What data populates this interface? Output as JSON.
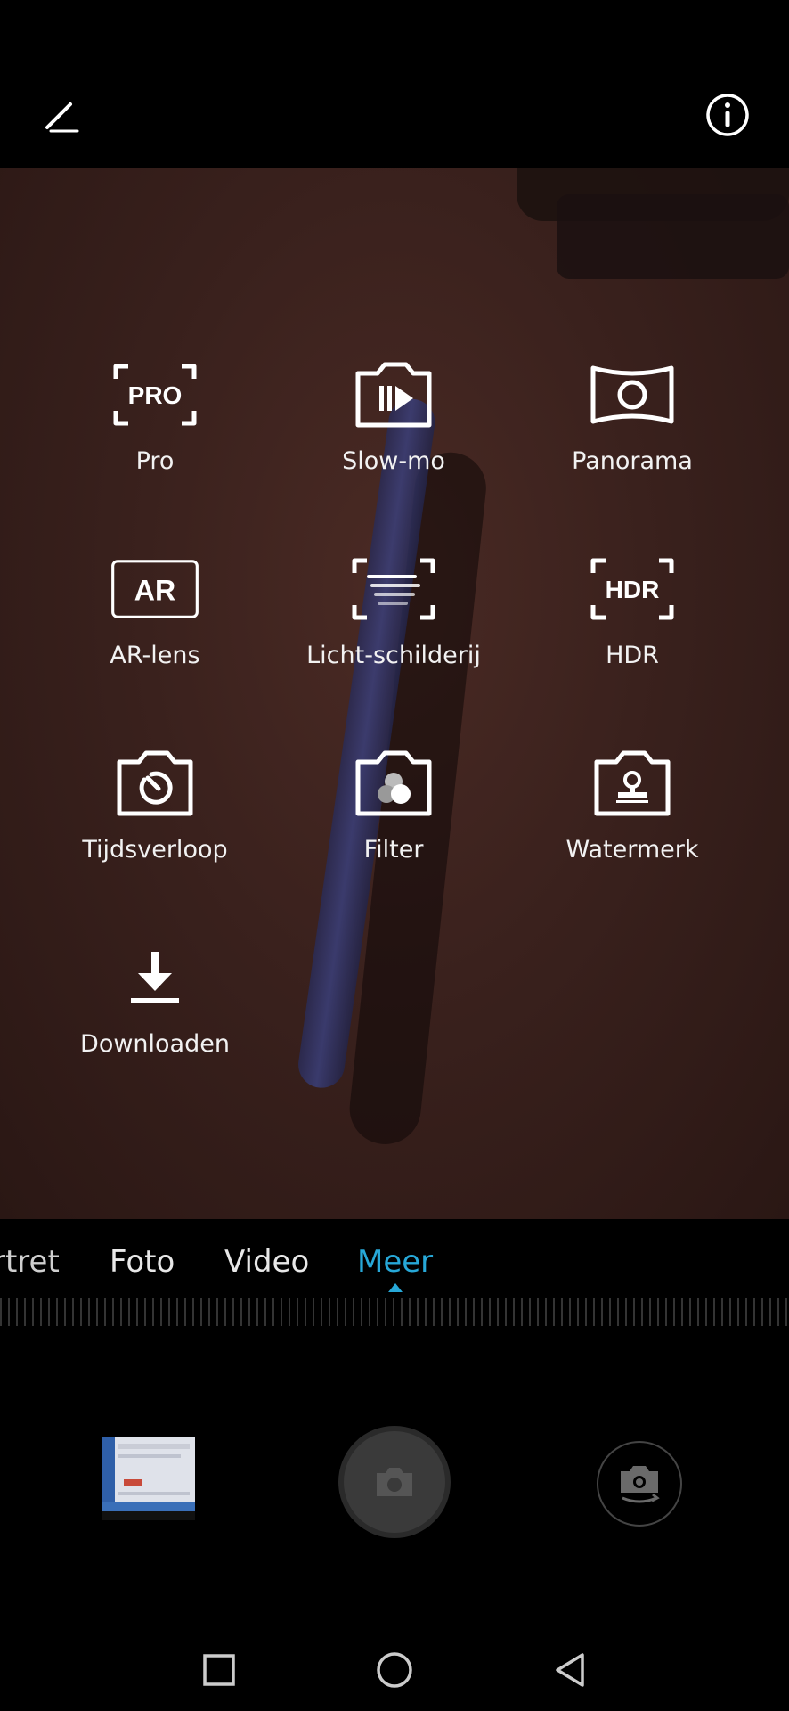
{
  "top_bar": {
    "edit_icon": "pencil-icon",
    "info_icon": "info-icon"
  },
  "modes": [
    {
      "label": "Pro",
      "icon": "pro-icon",
      "icon_text": "PRO"
    },
    {
      "label": "Slow-mo",
      "icon": "slow-motion-icon"
    },
    {
      "label": "Panorama",
      "icon": "panorama-icon"
    },
    {
      "label": "AR-lens",
      "icon": "ar-lens-icon",
      "icon_text": "AR"
    },
    {
      "label": "Licht-schilderij",
      "icon": "light-painting-icon"
    },
    {
      "label": "HDR",
      "icon": "hdr-icon",
      "icon_text": "HDR"
    },
    {
      "label": "Tijdsverloop",
      "icon": "time-lapse-icon"
    },
    {
      "label": "Filter",
      "icon": "filter-icon"
    },
    {
      "label": "Watermerk",
      "icon": "watermark-icon"
    },
    {
      "label": "Downloaden",
      "icon": "download-icon"
    }
  ],
  "mode_tabs": [
    {
      "label": "rtret"
    },
    {
      "label": "Foto"
    },
    {
      "label": "Video"
    },
    {
      "label": "Meer",
      "active": true
    }
  ],
  "colors": {
    "accent": "#27a8d8",
    "background": "#000000"
  },
  "controls": {
    "gallery_thumbnail": "gallery-thumbnail",
    "shutter_icon": "camera-icon",
    "switch_camera_icon": "switch-camera-icon"
  },
  "nav": {
    "recents": "square-icon",
    "home": "circle-icon",
    "back": "triangle-back-icon"
  }
}
